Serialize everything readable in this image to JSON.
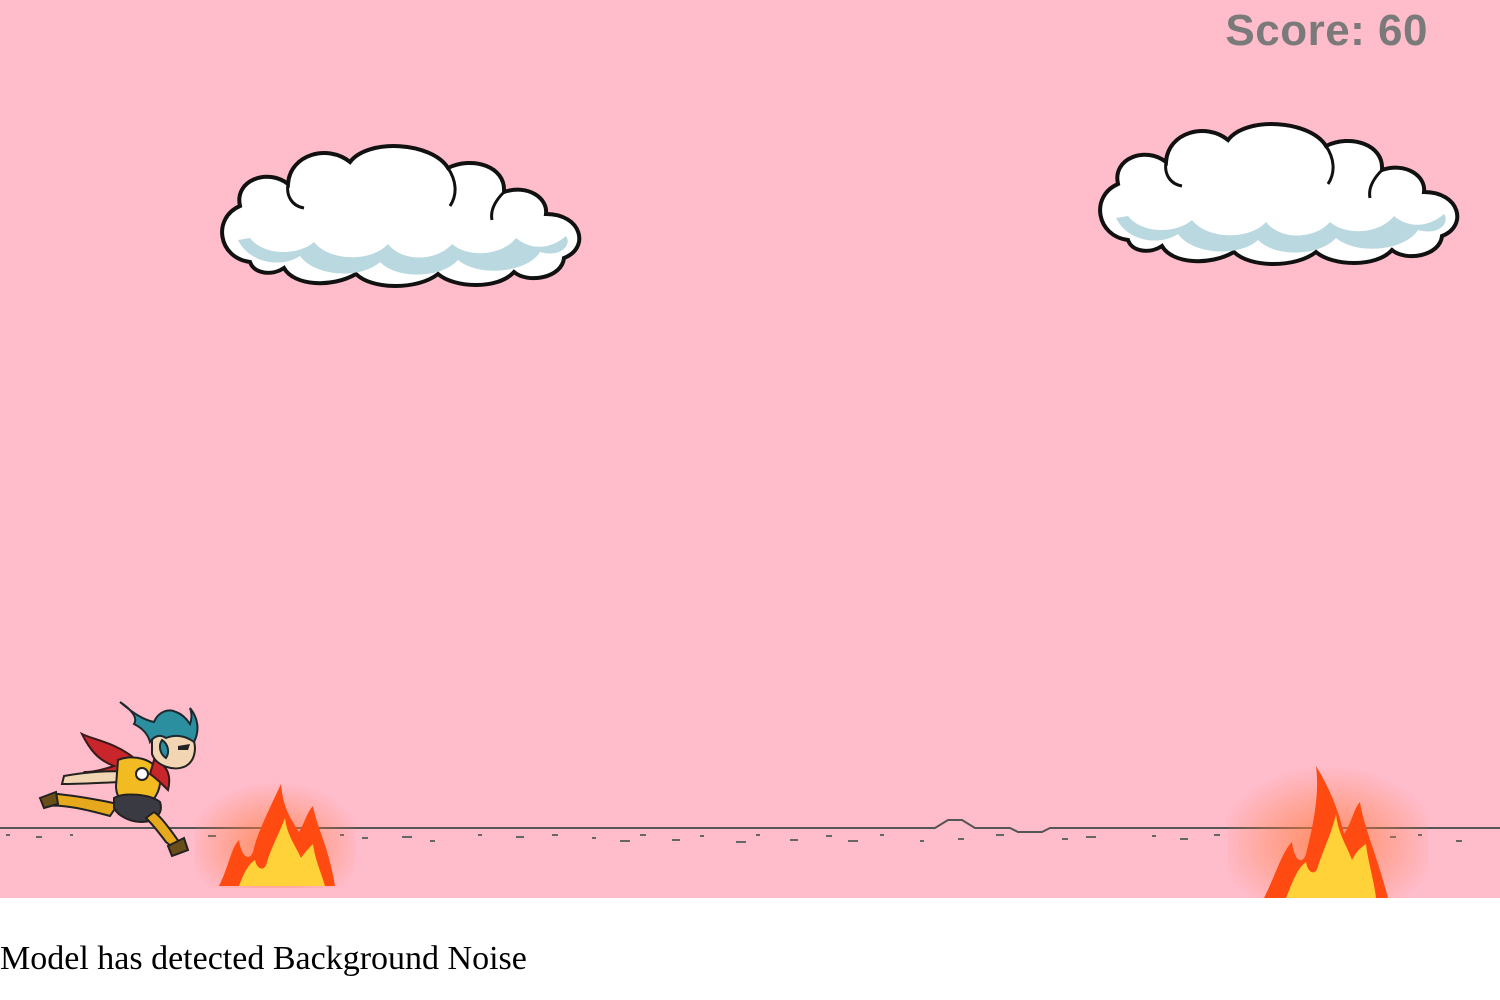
{
  "game": {
    "score_text": "Score: 60",
    "colors": {
      "sky": "#ffbccb",
      "score": "#7a7a7a",
      "cloud_fill": "#ffffff",
      "cloud_shadow": "#b9d8e0",
      "ground_line": "#555555",
      "fire_outer": "#ff4a12",
      "fire_inner": "#ffd23a"
    },
    "sprites": {
      "clouds": [
        "cloud-icon",
        "cloud-icon"
      ],
      "obstacles": [
        "fire-icon",
        "fire-icon"
      ],
      "player": "runner-character-icon"
    }
  },
  "status": {
    "message": "Model has detected Background Noise"
  }
}
